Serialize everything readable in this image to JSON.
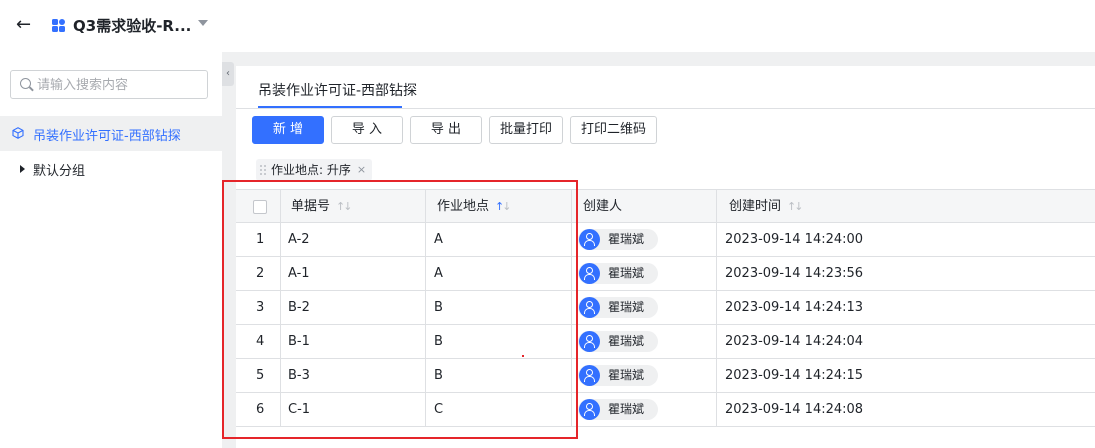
{
  "header": {
    "back_icon": "arrow-left-icon",
    "app_icon": "app-grid-icon",
    "title": "Q3需求验收-R...",
    "caret_icon": "caret-down-icon"
  },
  "sidebar": {
    "search_placeholder": "请输入搜索内容",
    "items": [
      {
        "label": "吊装作业许可证-西部钻探",
        "icon": "cube-icon",
        "active": true
      },
      {
        "label": "默认分组",
        "icon": "caret-right-icon",
        "active": false
      }
    ]
  },
  "main": {
    "tab": "吊装作业许可证-西部钻探",
    "buttons": {
      "new": "新 增",
      "import": "导 入",
      "export": "导 出",
      "batch_print": "批量打印",
      "print_qr": "打印二维码"
    },
    "sort_chip": {
      "label": "作业地点: 升序",
      "close": "×"
    },
    "table": {
      "headers": {
        "doc_no": "单据号",
        "location": "作业地点",
        "creator": "创建人",
        "created_at": "创建时间"
      },
      "rows": [
        {
          "index": "1",
          "doc_no": "A-2",
          "location": "A",
          "creator": "瞿瑞斌",
          "created_at": "2023-09-14 14:24:00"
        },
        {
          "index": "2",
          "doc_no": "A-1",
          "location": "A",
          "creator": "瞿瑞斌",
          "created_at": "2023-09-14 14:23:56"
        },
        {
          "index": "3",
          "doc_no": "B-2",
          "location": "B",
          "creator": "瞿瑞斌",
          "created_at": "2023-09-14 14:24:13"
        },
        {
          "index": "4",
          "doc_no": "B-1",
          "location": "B",
          "creator": "瞿瑞斌",
          "created_at": "2023-09-14 14:24:04"
        },
        {
          "index": "5",
          "doc_no": "B-3",
          "location": "B",
          "creator": "瞿瑞斌",
          "created_at": "2023-09-14 14:24:15"
        },
        {
          "index": "6",
          "doc_no": "C-1",
          "location": "C",
          "creator": "瞿瑞斌",
          "created_at": "2023-09-14 14:24:08"
        }
      ]
    }
  },
  "colors": {
    "accent": "#3370ff",
    "highlight_box": "#e5252a"
  }
}
